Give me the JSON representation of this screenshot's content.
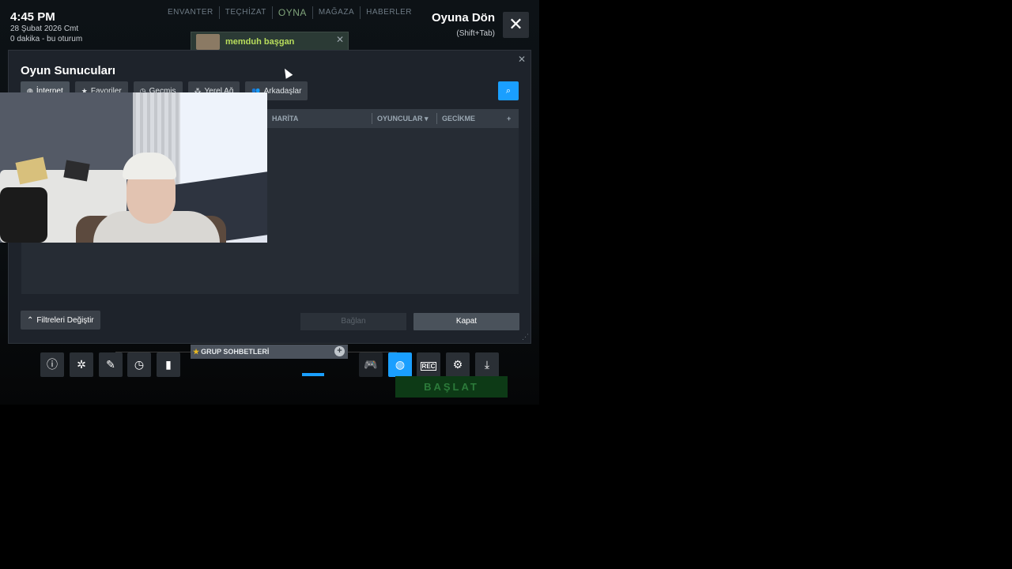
{
  "overlay": {
    "time": "4:45 PM",
    "date": "28 Şubat 2026 Cmt",
    "session": "0 dakika - bu oturum",
    "return_title": "Oyuna Dön",
    "return_hint": "(Shift+Tab)",
    "close_glyph": "✕"
  },
  "top_nav": [
    "ENVANTER",
    "TEÇHİZAT",
    "OYNA",
    "MAĞAZA",
    "HABERLER"
  ],
  "friend_popup": {
    "name": "memduh başgan",
    "close": "✕"
  },
  "dialog": {
    "title": "Oyun Sunucuları",
    "close": "✕",
    "tabs": [
      {
        "label": "İnternet",
        "icon": "globe-icon"
      },
      {
        "label": "Favoriler",
        "icon": "star-icon"
      },
      {
        "label": "Geçmiş",
        "icon": "clock-icon"
      },
      {
        "label": "Yerel Ağ",
        "icon": "network-icon"
      },
      {
        "label": "Arkadaşlar",
        "icon": "friends-icon"
      }
    ],
    "columns": {
      "map": "HARİTA",
      "players": "OYUNCULAR ▾",
      "latency": "GECİKME",
      "add": "+"
    },
    "filter_button": "Filtreleri Değiştir",
    "connect_button": "Bağlan",
    "close_button": "Kapat"
  },
  "toolbar": {
    "group_chat": "GRUP SOHBETLERİ",
    "launch": "BAŞLAT",
    "buttons": [
      "info-icon",
      "achievements-icon",
      "pencil-icon",
      "timer-icon",
      "guide-icon",
      "controller-icon",
      "globe-icon",
      "rec-icon",
      "gear-icon",
      "download-icon"
    ]
  },
  "colors": {
    "accent": "#1a9fff",
    "friend": "#b9de5c",
    "launch": "#0d3a16"
  }
}
